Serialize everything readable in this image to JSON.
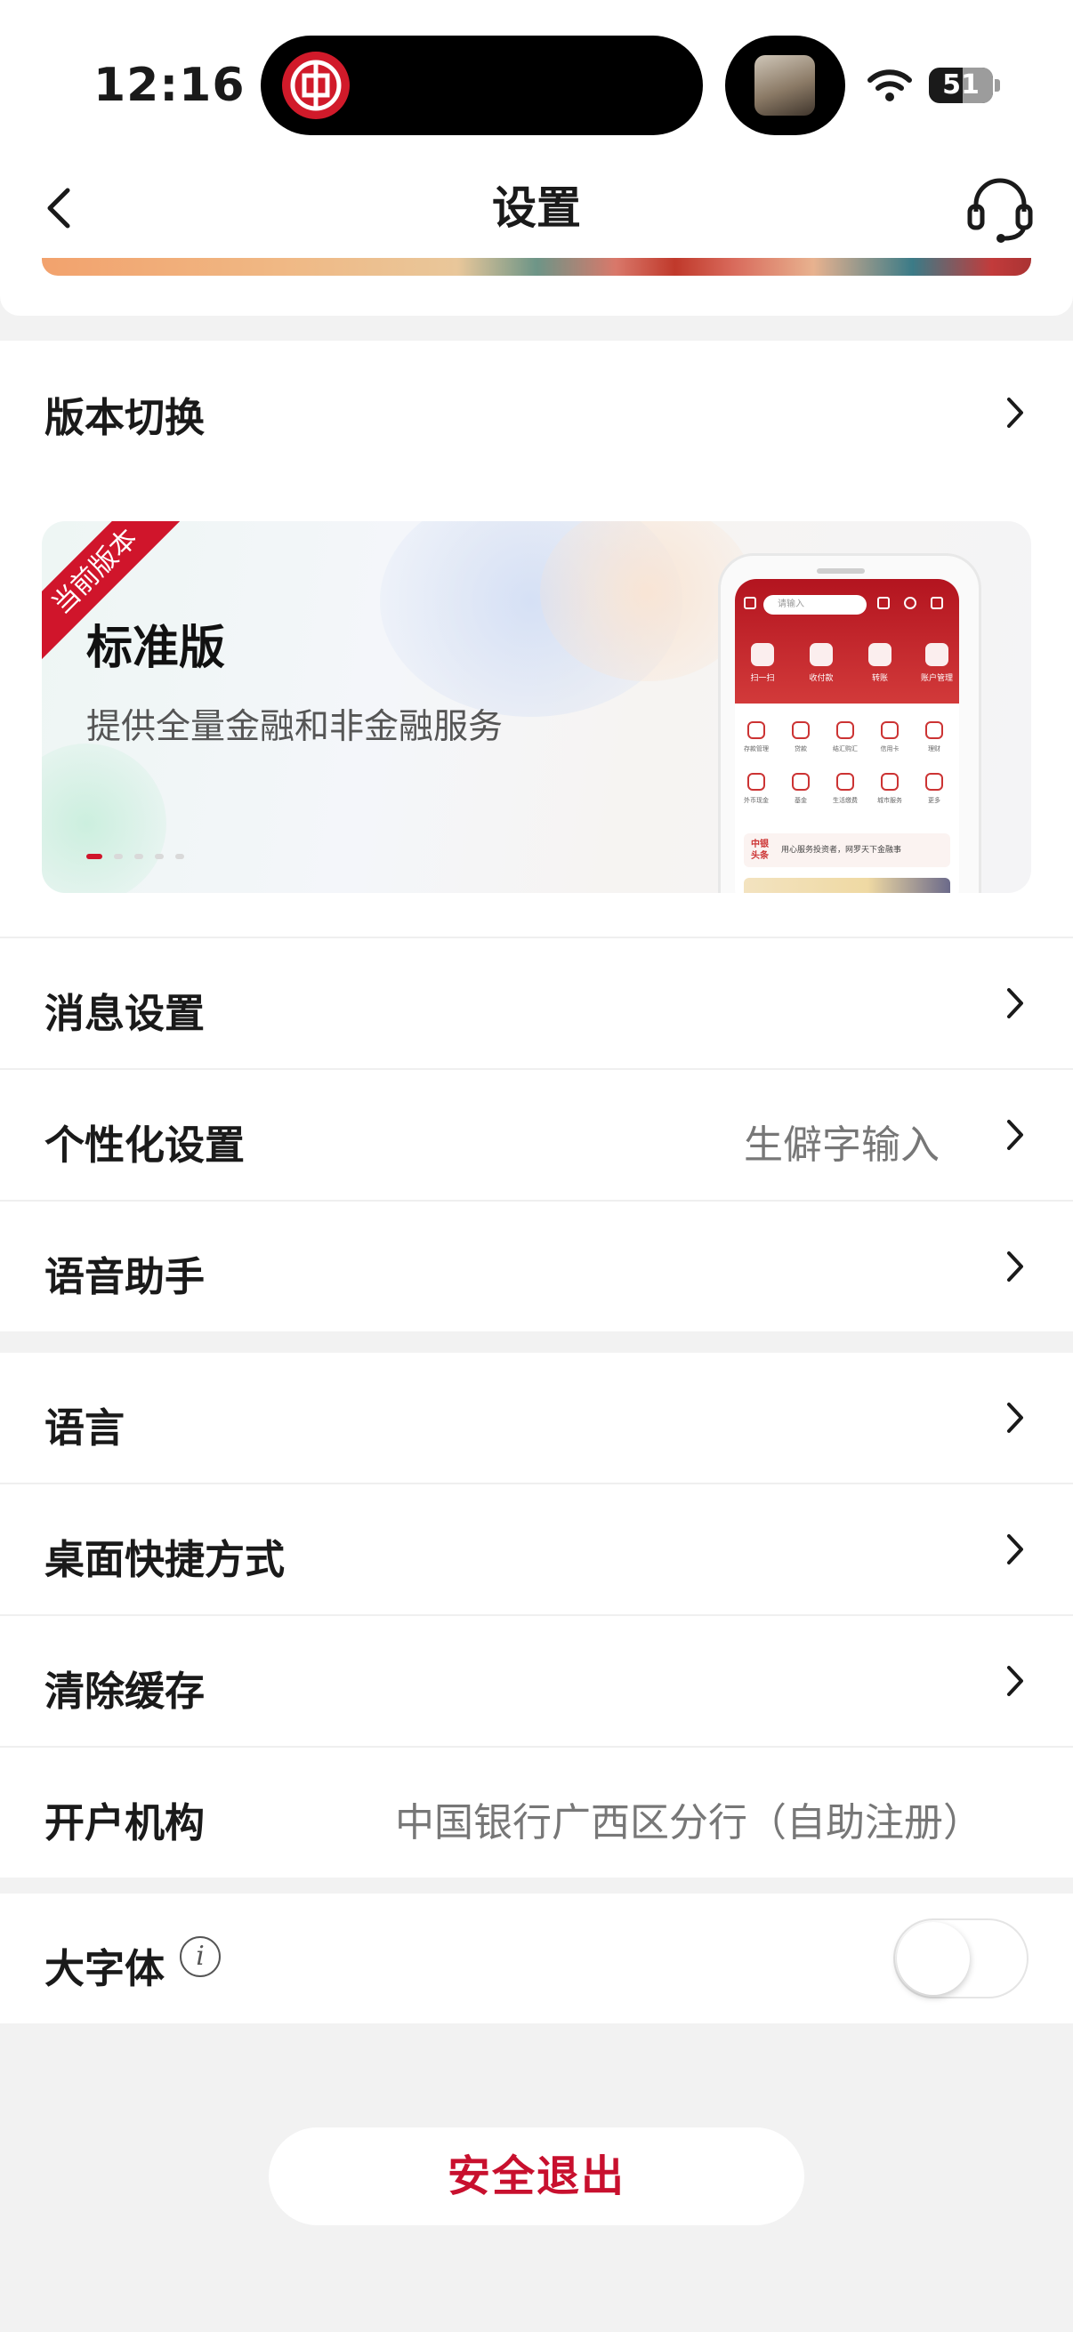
{
  "status_bar": {
    "time": "12:16",
    "battery": "51"
  },
  "nav": {
    "title": "设置"
  },
  "version_switch": {
    "label": "版本切换",
    "current_badge": "当前版本",
    "edition_title": "标准版",
    "edition_desc": "提供全量金融和非金融服务",
    "carousel_pages": 5,
    "carousel_active": 1
  },
  "mockup": {
    "search_placeholder": "请输入",
    "quick_actions": [
      "扫一扫",
      "收付款",
      "转账",
      "账户管理"
    ],
    "grid": [
      "存款管理",
      "贷款",
      "结汇购汇",
      "信用卡",
      "理财",
      "外币现金",
      "基金",
      "生活缴费",
      "城市服务",
      "更多"
    ],
    "news_tag": "中银头条",
    "news_text": "用心服务投资者，网罗天下金融事"
  },
  "menu_group_1": [
    {
      "label": "消息设置",
      "value": ""
    },
    {
      "label": "个性化设置",
      "value": "生僻字输入"
    },
    {
      "label": "语音助手",
      "value": ""
    }
  ],
  "menu_group_2": [
    {
      "label": "语言",
      "value": ""
    },
    {
      "label": "桌面快捷方式",
      "value": ""
    },
    {
      "label": "清除缓存",
      "value": ""
    },
    {
      "label": "开户机构",
      "value": "中国银行广西区分行（自助注册）"
    }
  ],
  "large_font": {
    "label": "大字体",
    "info_icon": "i",
    "enabled": false
  },
  "logout": {
    "label": "安全退出"
  },
  "colors": {
    "accent": "#c8102e",
    "background": "#f2f2f2"
  }
}
